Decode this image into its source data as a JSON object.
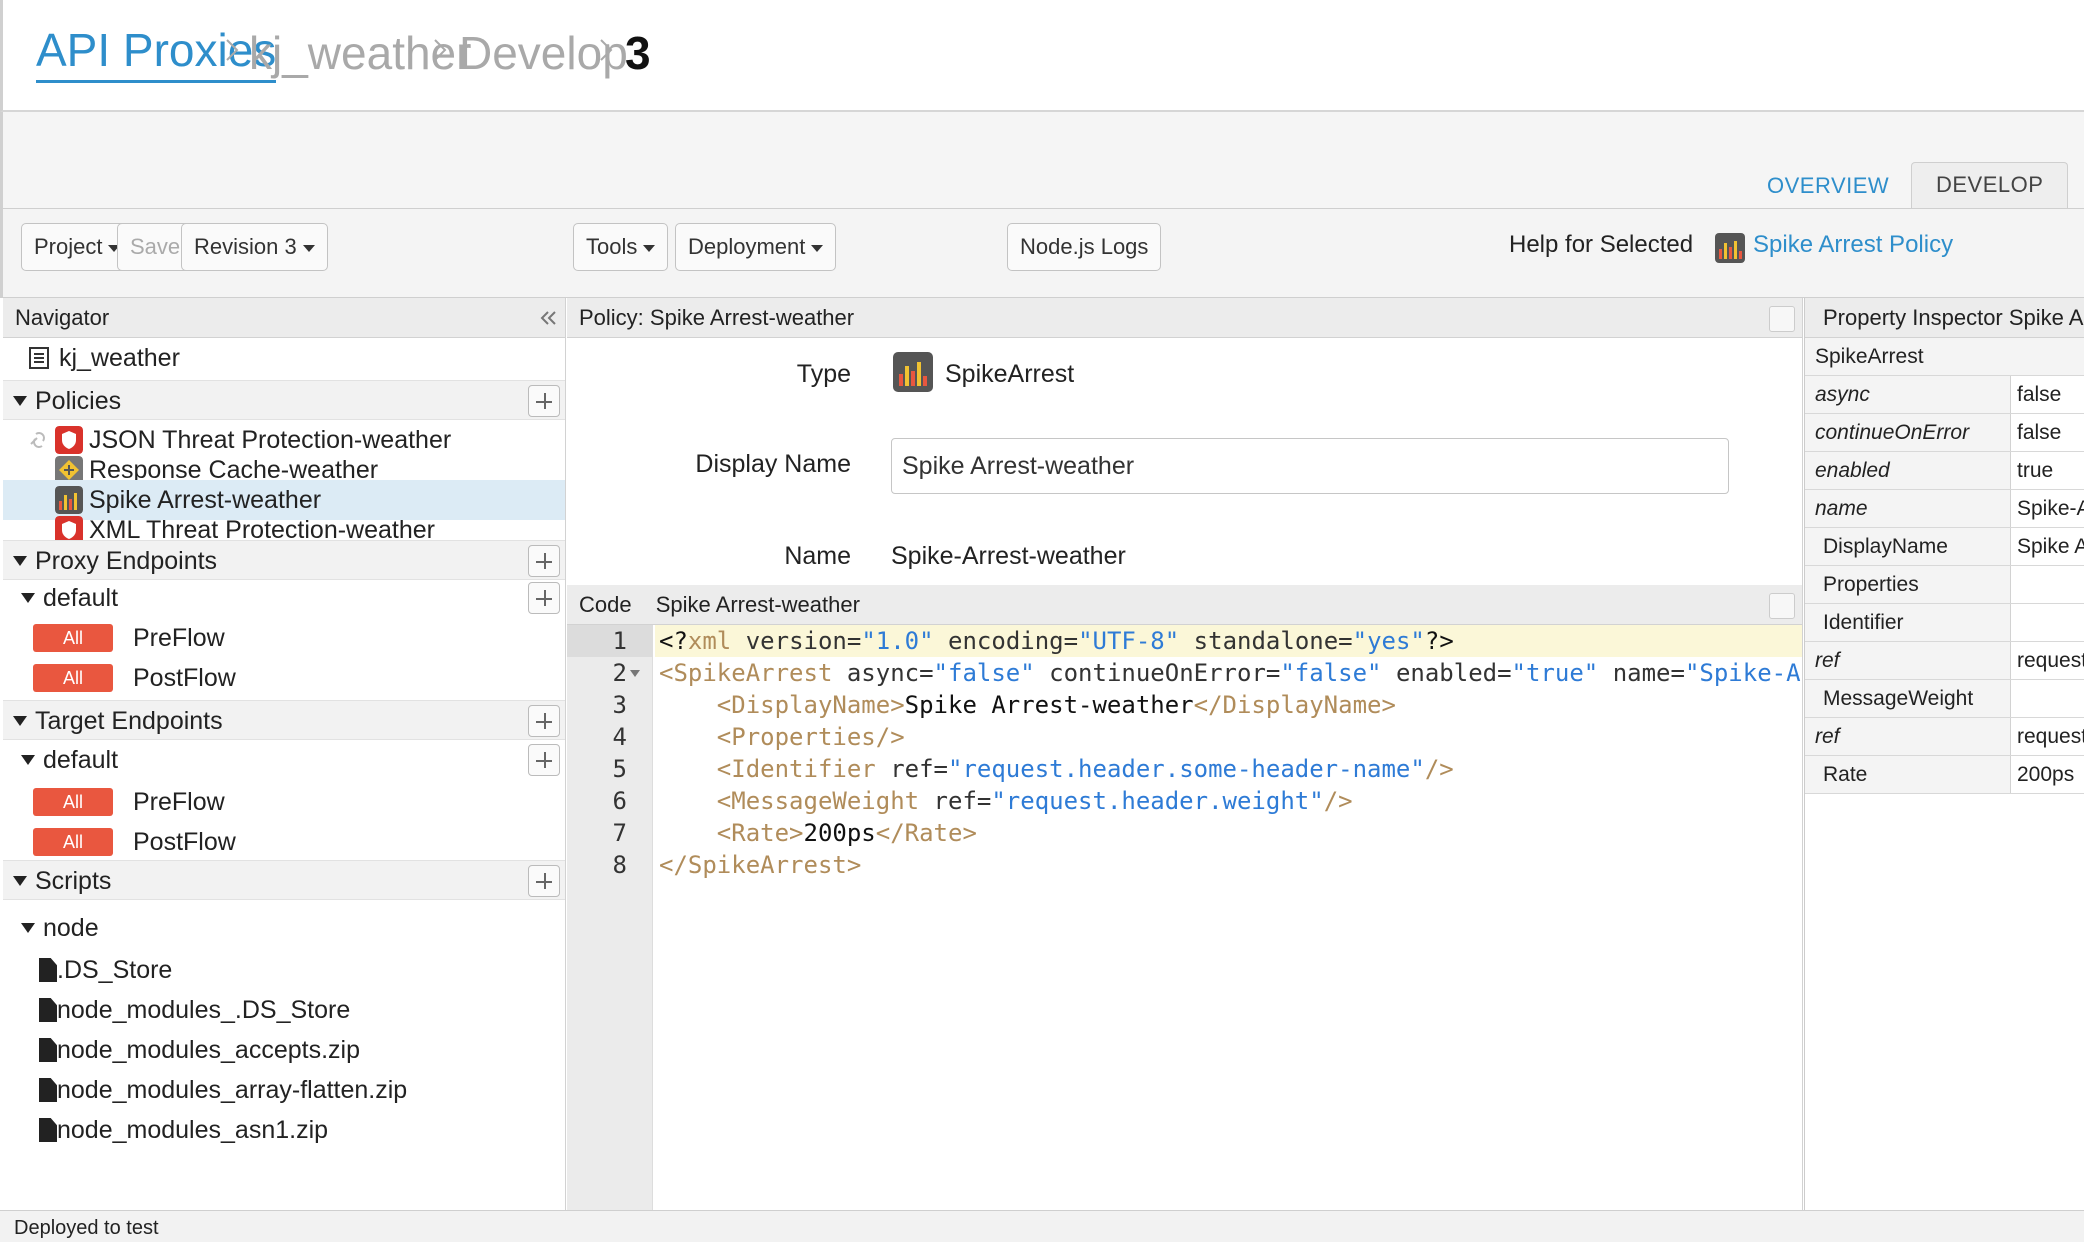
{
  "breadcrumb": {
    "root": "API Proxies",
    "proxy": "kj_weather",
    "section": "Develop",
    "revision": "3"
  },
  "tabs": {
    "overview": "OVERVIEW",
    "develop": "DEVELOP"
  },
  "toolbar": {
    "project": "Project",
    "save": "Save",
    "revision": "Revision 3",
    "tools": "Tools",
    "deployment": "Deployment",
    "node_logs": "Node.js Logs",
    "help_label": "Help for Selected",
    "help_link": "Spike Arrest Policy"
  },
  "navigator": {
    "title": "Navigator",
    "proxy_name": "kj_weather",
    "policies_label": "Policies",
    "policies": [
      "JSON Threat Protection-weather",
      "Response Cache-weather",
      "Spike Arrest-weather",
      "XML Threat Protection-weather"
    ],
    "proxy_endpoints_label": "Proxy Endpoints",
    "proxy_default": "default",
    "target_endpoints_label": "Target Endpoints",
    "target_default": "default",
    "all_badge": "All",
    "preflow": "PreFlow",
    "postflow": "PostFlow",
    "scripts_label": "Scripts",
    "scripts_folder": "node",
    "files": [
      ".DS_Store",
      "node_modules_.DS_Store",
      "node_modules_accepts.zip",
      "node_modules_array-flatten.zip",
      "node_modules_asn1.zip"
    ]
  },
  "policy": {
    "header": "Policy: Spike Arrest-weather",
    "type_label": "Type",
    "type_value": "SpikeArrest",
    "display_name_label": "Display Name",
    "display_name_value": "Spike Arrest-weather",
    "name_label": "Name",
    "name_value": "Spike-Arrest-weather"
  },
  "code": {
    "label": "Code",
    "title": "Spike Arrest-weather",
    "line_numbers": [
      "1",
      "2",
      "3",
      "4",
      "5",
      "6",
      "7",
      "8"
    ]
  },
  "inspector": {
    "title": "Property Inspector  Spike Arrest-weather",
    "root": "SpikeArrest",
    "rows": [
      {
        "key": "async",
        "value": "false"
      },
      {
        "key": "continueOnError",
        "value": "false"
      },
      {
        "key": "enabled",
        "value": "true"
      },
      {
        "key": "name",
        "value": "Spike-Arrest-weather"
      },
      {
        "key": "DisplayName",
        "value": "Spike Arrest-weather"
      },
      {
        "key": "Properties",
        "value": ""
      },
      {
        "key": "Identifier",
        "value": ""
      },
      {
        "key": "ref",
        "value": "request.header.some-header-name"
      },
      {
        "key": "MessageWeight",
        "value": ""
      },
      {
        "key": "ref",
        "value": "request.header.weight"
      },
      {
        "key": "Rate",
        "value": "200ps"
      }
    ]
  },
  "status": {
    "text": "Deployed to test"
  },
  "colors": {
    "accent": "#2e8ecb",
    "badge": "#e9573f",
    "selected_row": "#dcebf5"
  }
}
